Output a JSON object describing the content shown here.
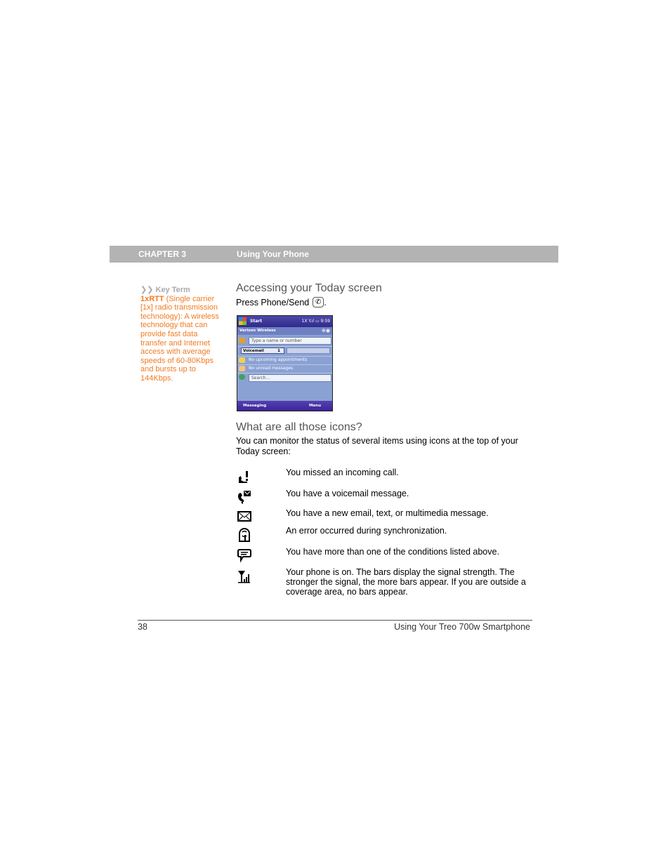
{
  "header": {
    "chapter": "CHAPTER 3",
    "title": "Using Your Phone"
  },
  "sidebar": {
    "marker": "❯❯",
    "heading": "Key Term",
    "term": "1xRTT",
    "definition": " (Single carrier [1x] radio transmission technology): A wireless technology that can provide fast data transfer and Internet access with average speeds of 60-80Kbps and bursts up to 144Kbps."
  },
  "section1": {
    "heading": "Accessing your Today screen",
    "instruction": "Press Phone/Send",
    "instruction_end": ".",
    "send_icon": "phone-send-icon"
  },
  "phone_screen": {
    "start_label": "Start",
    "status_text": "1X  Y.ıl  ▭ 9:59",
    "carrier": "Verizon Wireless",
    "dial_placeholder": "Type a name or number",
    "voicemail_label": "Voicemail",
    "voicemail_count": "1",
    "appointments": "No upcoming appointments",
    "messages": "No unread messages",
    "search_placeholder": "Search...",
    "soft_left": "Messaging",
    "soft_right": "Menu"
  },
  "section2": {
    "heading": "What are all those icons?",
    "intro": "You can monitor the status of several items using icons at the top of your Today screen:",
    "icons": [
      {
        "icon": "missed-call-icon",
        "text": "You missed an incoming call."
      },
      {
        "icon": "voicemail-icon",
        "text": "You have a voicemail message."
      },
      {
        "icon": "envelope-icon",
        "text": "You have a new email, text, or multimedia message."
      },
      {
        "icon": "sync-error-icon",
        "text": "An error occurred during synchronization."
      },
      {
        "icon": "speech-bubble-icon",
        "text": "You have more than one of the conditions listed above."
      },
      {
        "icon": "signal-strength-icon",
        "text": "Your phone is on. The bars display the signal strength. The stronger the signal, the more bars appear. If you are outside a coverage area, no bars appear."
      }
    ]
  },
  "footer": {
    "page_number": "38",
    "book_title": "Using Your Treo 700w Smartphone"
  }
}
